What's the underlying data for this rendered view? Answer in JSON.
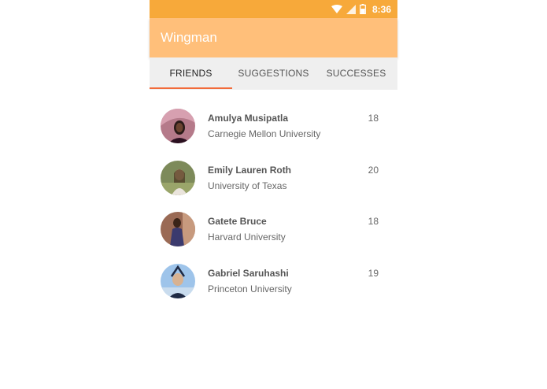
{
  "status_bar": {
    "time": "8:36"
  },
  "app_bar": {
    "title": "Wingman",
    "color": "#ffbf7a"
  },
  "tabs": [
    {
      "label": "FRIENDS",
      "active": true
    },
    {
      "label": "SUGGESTIONS",
      "active": false
    },
    {
      "label": "SUCCESSES",
      "active": false
    }
  ],
  "friends": [
    {
      "name": "Amulya Musipatla",
      "school": "Carnegie Mellon University",
      "age": "18"
    },
    {
      "name": "Emily Lauren Roth",
      "school": "University of Texas",
      "age": "20"
    },
    {
      "name": "Gatete Bruce",
      "school": "Harvard University",
      "age": "18"
    },
    {
      "name": "Gabriel Saruhashi",
      "school": "Princeton University",
      "age": "19"
    }
  ],
  "colors": {
    "status_bar": "#f7a93a",
    "tab_indicator": "#f26b3a",
    "tab_background": "#efefef"
  }
}
